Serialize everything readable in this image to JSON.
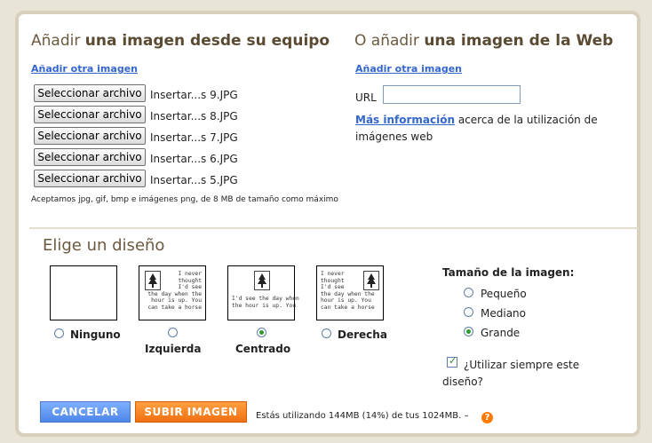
{
  "upload": {
    "title_prefix": "Añadir",
    "title_bold": "una imagen desde su equipo",
    "add_another_link": "Añadir otra imagen",
    "file_button_label": "Seleccionar archivo",
    "files": [
      "Insertar...s 9.JPG",
      "Insertar...s 8.JPG",
      "Insertar...s 7.JPG",
      "Insertar...s 6.JPG",
      "Insertar...s 5.JPG"
    ],
    "formats_note": "Aceptamos jpg, gif, bmp e imágenes png, de 8 MB de tamaño como máximo"
  },
  "web": {
    "title_prefix": "O añadir",
    "title_bold": "una imagen de la Web",
    "add_another_link": "Añadir otra imagen",
    "url_label": "URL",
    "url_value": "",
    "more_info_link": "Más información",
    "more_info_text_1": "acerca de la utilización de",
    "more_info_text_2": "imágenes web"
  },
  "layout": {
    "title": "Elige un diseño",
    "thumb_text": "I never\nthought\nI'd see\nthe day when the\nhour is up. You\ncan take a horse",
    "options": [
      {
        "label": "Ninguno",
        "selected": false
      },
      {
        "label": "Izquierda",
        "selected": false
      },
      {
        "label": "Centrado",
        "selected": true
      },
      {
        "label": "Derecha",
        "selected": false
      }
    ],
    "size_title": "Tamaño de la imagen:",
    "sizes": [
      {
        "label": "Pequeño",
        "selected": false
      },
      {
        "label": "Mediano",
        "selected": false
      },
      {
        "label": "Grande",
        "selected": true
      }
    ],
    "always_use_line1": "¿Utilizar siempre este",
    "always_use_line2": "diseño?",
    "always_use_checked": true
  },
  "footer": {
    "cancel_label": "CANCELAR",
    "upload_label": "SUBIR IMAGEN",
    "usage_text": "Estás utilizando 144MB (14%) de tus 1024MB. –",
    "help_glyph": "?"
  },
  "colors": {
    "cancel_button": "#5b8fef",
    "upload_button": "#f57c1f",
    "heading": "#6b5a40",
    "link": "#3366cc",
    "selected_radio": "#2e9b2e"
  }
}
